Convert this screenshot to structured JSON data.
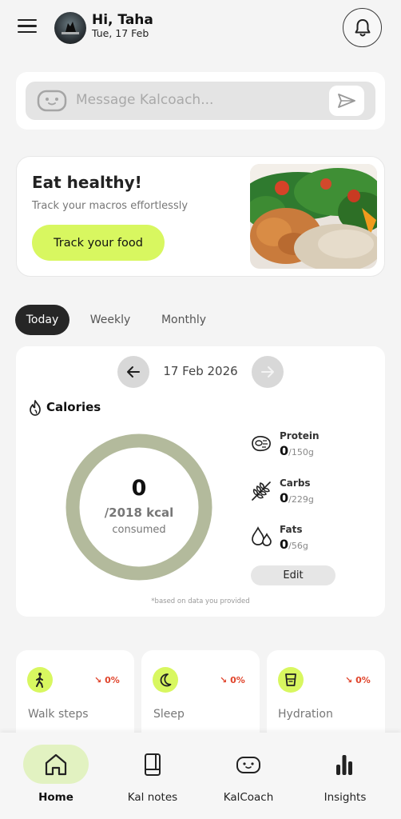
{
  "header": {
    "greeting": "Hi, Taha",
    "date": "Tue, 17 Feb"
  },
  "message_bar": {
    "placeholder": "Message Kalcoach..."
  },
  "hero": {
    "title": "Eat healthy!",
    "subtitle": "Track your macros effortlessly",
    "button_label": "Track your food"
  },
  "period_tabs": [
    {
      "label": "Today",
      "selected": true
    },
    {
      "label": "Weekly",
      "selected": false
    },
    {
      "label": "Monthly",
      "selected": false
    }
  ],
  "calories": {
    "current_date": "17 Feb 2026",
    "section_label": "Calories",
    "consumed_value": "0",
    "target_text": "/2018 kcal",
    "consumed_label": "consumed",
    "progress_fraction": 0,
    "macros": [
      {
        "label": "Protein",
        "value": "0",
        "target": "/150g",
        "icon": "steak-icon"
      },
      {
        "label": "Carbs",
        "value": "0",
        "target": "/229g",
        "icon": "wheat-icon"
      },
      {
        "label": "Fats",
        "value": "0",
        "target": "/56g",
        "icon": "droplets-icon"
      }
    ],
    "edit_label": "Edit",
    "footnote": "*based on data you provided"
  },
  "stats": [
    {
      "label": "Walk steps",
      "change": "0%",
      "icon": "walking-icon"
    },
    {
      "label": "Sleep",
      "change": "0%",
      "icon": "moon-icon"
    },
    {
      "label": "Hydration",
      "change": "0%",
      "icon": "glass-icon"
    }
  ],
  "bottom_nav": [
    {
      "label": "Home",
      "active": true,
      "icon": "home-icon"
    },
    {
      "label": "Kal notes",
      "active": false,
      "icon": "notebook-icon"
    },
    {
      "label": "KalCoach",
      "active": false,
      "icon": "robot-icon"
    },
    {
      "label": "Insights",
      "active": false,
      "icon": "bar-chart-icon"
    }
  ],
  "colors": {
    "accent_lime": "#d8f760",
    "ring_color": "#b3ba9c",
    "negative_change": "#e0442b",
    "dark_tab": "#262626"
  }
}
